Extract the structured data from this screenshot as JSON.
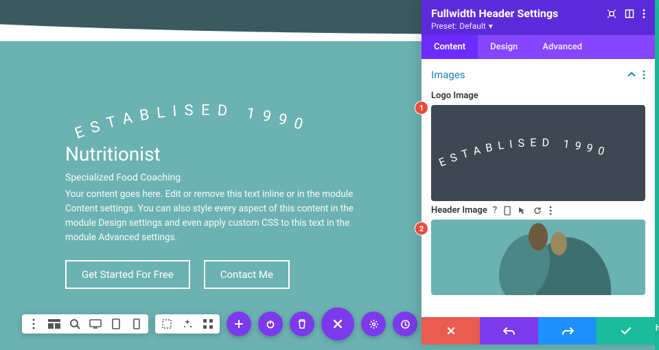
{
  "hero": {
    "arc_text": "ESTABLISED 1990",
    "title": "Nutritionist",
    "subtitle": "Specialized Food Coaching",
    "body": "Your content goes here. Edit or remove this text inline or in the module Content settings. You can also style every aspect of this content in the module Design settings and even apply custom CSS to this text in the module Advanced settings.",
    "btn_primary": "Get Started For Free",
    "btn_secondary": "Contact Me"
  },
  "panel": {
    "title": "Fullwidth Header Settings",
    "preset_label": "Preset:",
    "preset_value": "Default",
    "tabs": {
      "content": "Content",
      "design": "Design",
      "advanced": "Advanced"
    },
    "active_tab": "Content",
    "section_title": "Images",
    "logo_label": "Logo Image",
    "logo_arc_text": "ESTABLISED 1990",
    "header_label": "Header Image"
  },
  "badges": {
    "one": "1",
    "two": "2"
  },
  "publish_peek": "sh",
  "colors": {
    "hero_bg": "#6cb2b2",
    "panel_head": "#5b2bd9",
    "panel_tabs": "#8645ff",
    "accent_link": "#1f7fb8",
    "cancel": "#e85c52",
    "undo": "#7c3aed",
    "redo": "#1e90ff",
    "save": "#1abc9c"
  }
}
